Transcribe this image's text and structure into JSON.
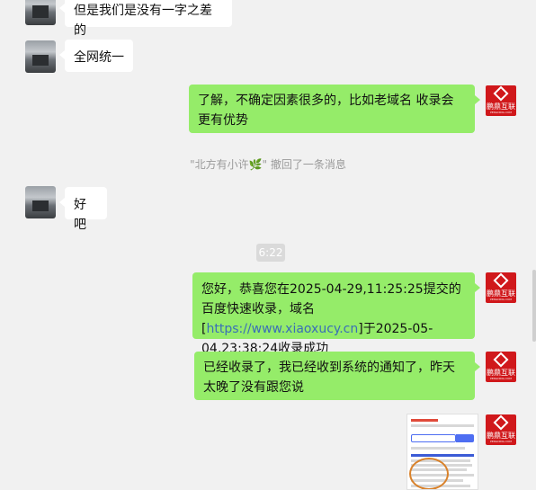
{
  "messages": {
    "m1": "但是我们是没有一字之差的",
    "m2": "全网统一",
    "m3": "了解，不确定因素很多的，比如老域名 收录会更有优势",
    "recall": "\"北方有小许🌿\" 撤回了一条消息",
    "m4": "好吧",
    "time": "6:22",
    "m5_part1": "您好，恭喜您在2025-04-29,11:25:25提交的百度快速收录，域名[",
    "m5_link": "https://www.xiaoxucy.cn",
    "m5_part2": "]于2025-05-04,23:38:24收录成功",
    "m6": "已经收录了，我已经收到系统的通知了，昨天太晚了没有跟您说"
  },
  "avatar_logo": {
    "text": "鹏鼎互联",
    "sub": "PENGDING.COM"
  },
  "colors": {
    "background": "#f1f1f1",
    "self_bubble": "#95ec69",
    "other_bubble": "#ffffff",
    "logo": "#d0181b"
  }
}
